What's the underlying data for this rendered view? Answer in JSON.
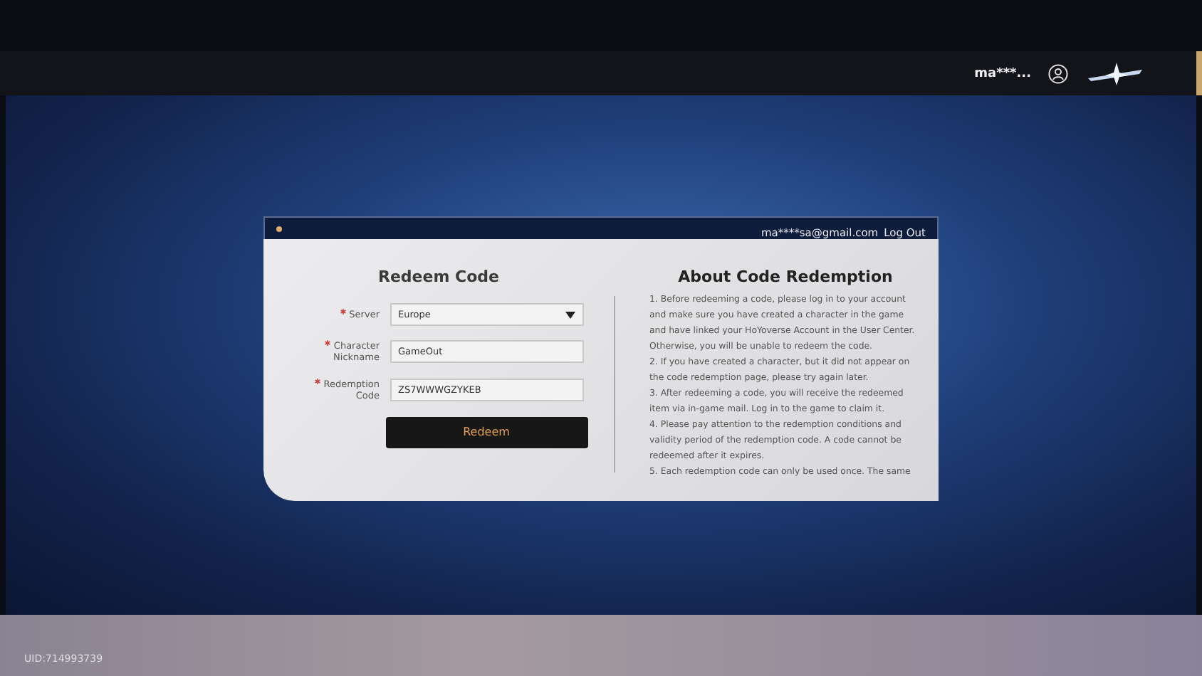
{
  "header": {
    "username": "ma***..."
  },
  "card": {
    "account": "ma****sa@gmail.com",
    "logout": "Log Out",
    "form": {
      "title": "Redeem Code",
      "fields": [
        {
          "kind": "select",
          "label": "Server",
          "required": true,
          "value": "Europe"
        },
        {
          "kind": "text",
          "label": "Character Nickname",
          "required": true,
          "value": "GameOut"
        },
        {
          "kind": "text",
          "label": "Redemption Code",
          "required": true,
          "value": "ZS7WWWGZYKEB"
        }
      ],
      "button": "Redeem"
    },
    "about": {
      "title": "About Code Redemption",
      "paragraphs": [
        "1. Before redeeming a code, please log in to your account and make sure you have created a character in the game and have linked your HoYoverse Account in the User Center. Otherwise, you will be unable to redeem the code.",
        "2. If you have created a character, but it did not appear on the code redemption page, please try again later.",
        "3. After redeeming a code, you will receive the redeemed item via in-game mail. Log in to the game to claim it.",
        "4. Please pay attention to the redemption conditions and validity period of the redemption code. A code cannot be redeemed after it expires.",
        "5. Each redemption code can only be used once. The same"
      ]
    }
  },
  "footer": {
    "uid": "UID:714993739"
  }
}
